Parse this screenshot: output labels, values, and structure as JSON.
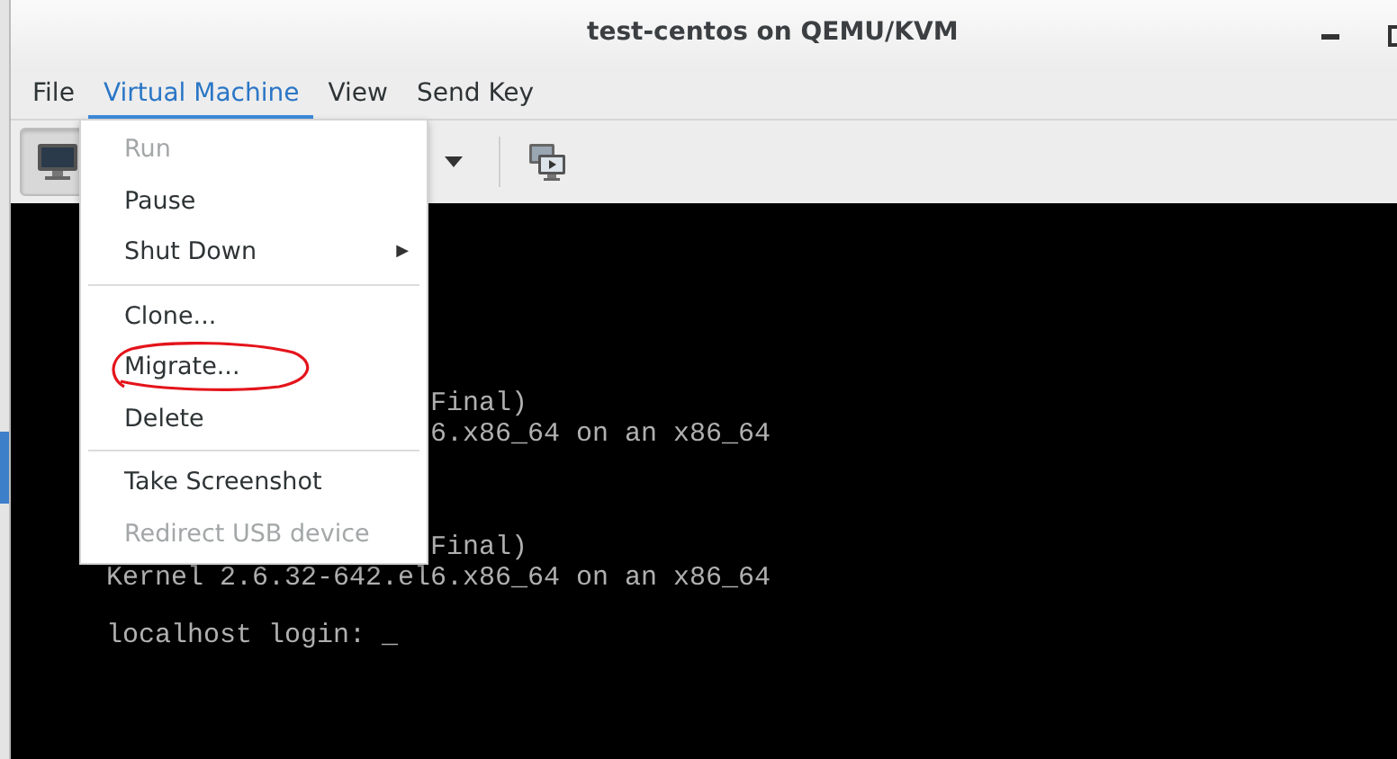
{
  "window": {
    "title": "test-centos on QEMU/KVM"
  },
  "menubar": [
    {
      "label": "File",
      "selected": false
    },
    {
      "label": "Virtual Machine",
      "selected": true
    },
    {
      "label": "View",
      "selected": false
    },
    {
      "label": "Send Key",
      "selected": false
    }
  ],
  "toolbar": {
    "console_button": {
      "selected": true
    }
  },
  "menu": {
    "items": [
      {
        "kind": "item",
        "label": "Run",
        "disabled": true
      },
      {
        "kind": "item",
        "label": "Pause",
        "disabled": false
      },
      {
        "kind": "submenu",
        "label": "Shut Down",
        "disabled": false,
        "arrow": "▶"
      },
      {
        "kind": "separator"
      },
      {
        "kind": "item",
        "label": "Clone...",
        "disabled": false
      },
      {
        "kind": "item",
        "label": "Migrate...",
        "disabled": false,
        "circled": true
      },
      {
        "kind": "item",
        "label": "Delete",
        "disabled": false
      },
      {
        "kind": "separator"
      },
      {
        "kind": "item",
        "label": "Take Screenshot",
        "disabled": false
      },
      {
        "kind": "item",
        "label": "Redirect USB device",
        "disabled": true
      }
    ]
  },
  "console": {
    "blocks": [
      [
        {
          "kind": "partial",
          "text": "Final)"
        },
        {
          "kind": "partial",
          "text": "6.x86_64 on an x86_64"
        }
      ],
      [
        {
          "kind": "partial",
          "text": "Final)"
        },
        {
          "kind": "full",
          "text": "Kernel 2.6.32-642.el6.x86_64 on an x86_64"
        }
      ],
      [
        {
          "kind": "full",
          "text": "localhost login: _"
        }
      ]
    ]
  }
}
